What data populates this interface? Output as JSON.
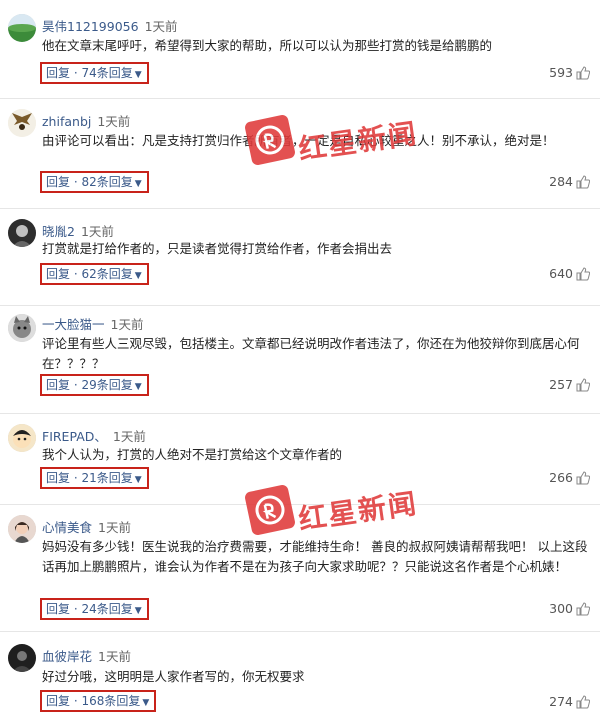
{
  "comments": [
    {
      "name": "昊伟112199056",
      "time": "1天前",
      "text": "他在文章末尾呼吁，希望得到大家的帮助，所以可以认为那些打赏的钱是给鹏鹏的",
      "reply": "回复 · 74条回复",
      "likes": "593",
      "avatar_icon": "landscape-avatar-icon"
    },
    {
      "name": "zhifanbj",
      "time": "1天前",
      "text": "由评论可以看出：凡是支持打赏归作者所有者，一定是自私心较重之人！别不承认，绝对是！",
      "reply": "回复 · 82条回复",
      "likes": "284",
      "avatar_icon": "eagle-avatar-icon"
    },
    {
      "name": "晓胤2",
      "time": "1天前",
      "text": "打赏就是打给作者的，只是读者觉得打赏给作者，作者会捐出去",
      "reply": "回复 · 62条回复",
      "likes": "640",
      "avatar_icon": "portrait-avatar-icon"
    },
    {
      "name": "一大脸猫一",
      "time": "1天前",
      "text": "评论里有些人三观尽毁，包括楼主。文章都已经说明改作者违法了，你还在为他狡辩你到底居心何在？？？？",
      "reply": "回复 · 29条回复",
      "likes": "257",
      "avatar_icon": "cat-avatar-icon"
    },
    {
      "name": "FIREPAD、",
      "time": "1天前",
      "text": "我个人认为，打赏的人绝对不是打赏给这个文章作者的",
      "reply": "回复 · 21条回复",
      "likes": "266",
      "avatar_icon": "cartoon-avatar-icon"
    },
    {
      "name": "心情美食",
      "time": "1天前",
      "text": "妈妈没有多少钱！医生说我的治疗费需要，才能维持生命！ 善良的叔叔阿姨请帮帮我吧！ 以上这段话再加上鹏鹏照片，谁会认为作者不是在为孩子向大家求助呢？？只能说这名作者是个心机婊！",
      "reply": "回复 · 24条回复",
      "likes": "300",
      "avatar_icon": "girl-avatar-icon"
    },
    {
      "name": "血彼岸花",
      "time": "1天前",
      "text": "好过分哦，这明明是人家作者写的，你无权要求",
      "reply": "回复 · 168条回复",
      "likes": "274",
      "avatar_icon": "dark-avatar-icon"
    }
  ],
  "watermark": {
    "text": "红星新闻",
    "color": "#e03a3a"
  },
  "icons": {
    "like": "thumbs-up-icon",
    "chevron": "chevron-down-icon"
  }
}
